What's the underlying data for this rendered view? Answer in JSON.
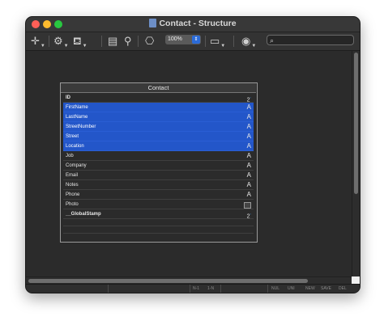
{
  "window": {
    "title": "Contact - Structure"
  },
  "toolbar": {
    "zoom": "100%",
    "search_placeholder": ""
  },
  "table": {
    "name": "Contact",
    "fields": [
      {
        "name": "ID",
        "type": "number",
        "type_glyph": "2",
        "selected": false,
        "bold": true
      },
      {
        "name": "FirstName",
        "type": "text",
        "type_glyph": "A",
        "selected": true,
        "bold": false
      },
      {
        "name": "LastName",
        "type": "text",
        "type_glyph": "A",
        "selected": true,
        "bold": false
      },
      {
        "name": "StreetNumber",
        "type": "text",
        "type_glyph": "A",
        "selected": true,
        "bold": false
      },
      {
        "name": "Street",
        "type": "text",
        "type_glyph": "A",
        "selected": true,
        "bold": false
      },
      {
        "name": "Location",
        "type": "text",
        "type_glyph": "A",
        "selected": true,
        "bold": false
      },
      {
        "name": "Job",
        "type": "text",
        "type_glyph": "A",
        "selected": false,
        "bold": false
      },
      {
        "name": "Company",
        "type": "text",
        "type_glyph": "A",
        "selected": false,
        "bold": false
      },
      {
        "name": "Email",
        "type": "text",
        "type_glyph": "A",
        "selected": false,
        "bold": false
      },
      {
        "name": "Notes",
        "type": "text",
        "type_glyph": "A",
        "selected": false,
        "bold": false
      },
      {
        "name": "Phone",
        "type": "text",
        "type_glyph": "A",
        "selected": false,
        "bold": false
      },
      {
        "name": "Photo",
        "type": "picture",
        "type_glyph": "",
        "selected": false,
        "bold": false
      },
      {
        "name": "__GlobalStamp",
        "type": "number",
        "type_glyph": "2",
        "selected": false,
        "bold": true
      }
    ]
  },
  "statusbar": {
    "relation_n1": "N-1",
    "relation_1n": "1-N",
    "nul": "NUL",
    "uni": "UNI",
    "new": "NEW",
    "save": "SAVE",
    "del": "DEL"
  },
  "colors": {
    "selection": "#2356c9",
    "background": "#2b2b2b"
  }
}
